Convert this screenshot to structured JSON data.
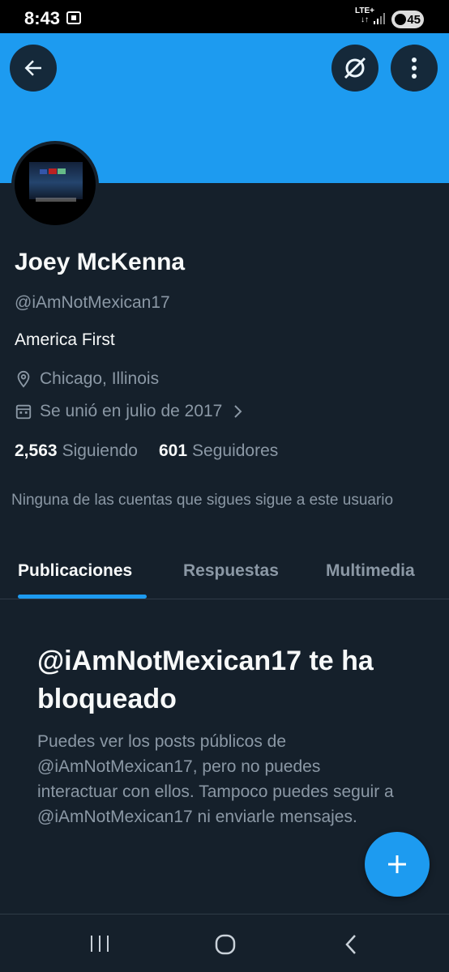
{
  "status_bar": {
    "time": "8:43",
    "network_top": "LTE+",
    "network_bottom": "↓↑",
    "battery": "45"
  },
  "header": {
    "back_icon": "arrow-left-icon",
    "grok_icon": "grok-icon",
    "more_icon": "more-vertical-icon"
  },
  "profile": {
    "name": "Joey McKenna",
    "handle": "@iAmNotMexican17",
    "bio": "America First",
    "location": "Chicago, Illinois",
    "joined": "Se unió en julio de 2017",
    "following_count": "2,563",
    "following_label": "Siguiendo",
    "followers_count": "601",
    "followers_label": "Seguidores",
    "mutual_note": "Ninguna de las cuentas que sigues sigue a este usuario"
  },
  "tabs": [
    {
      "label": "Publicaciones",
      "active": true
    },
    {
      "label": "Respuestas",
      "active": false
    },
    {
      "label": "Multimedia",
      "active": false
    }
  ],
  "blocked": {
    "title": "@iAmNotMexican17 te ha bloqueado",
    "body": "Puedes ver los posts públicos de @iAmNotMexican17, pero no puedes interactuar con ellos. Tampoco puedes seguir a @iAmNotMexican17 ni enviarle mensajes."
  },
  "fab": {
    "icon": "plus-icon"
  },
  "colors": {
    "background": "#15202b",
    "accent": "#1d9bf0",
    "text_primary": "#f7f9f9",
    "text_secondary": "#8b98a5"
  }
}
